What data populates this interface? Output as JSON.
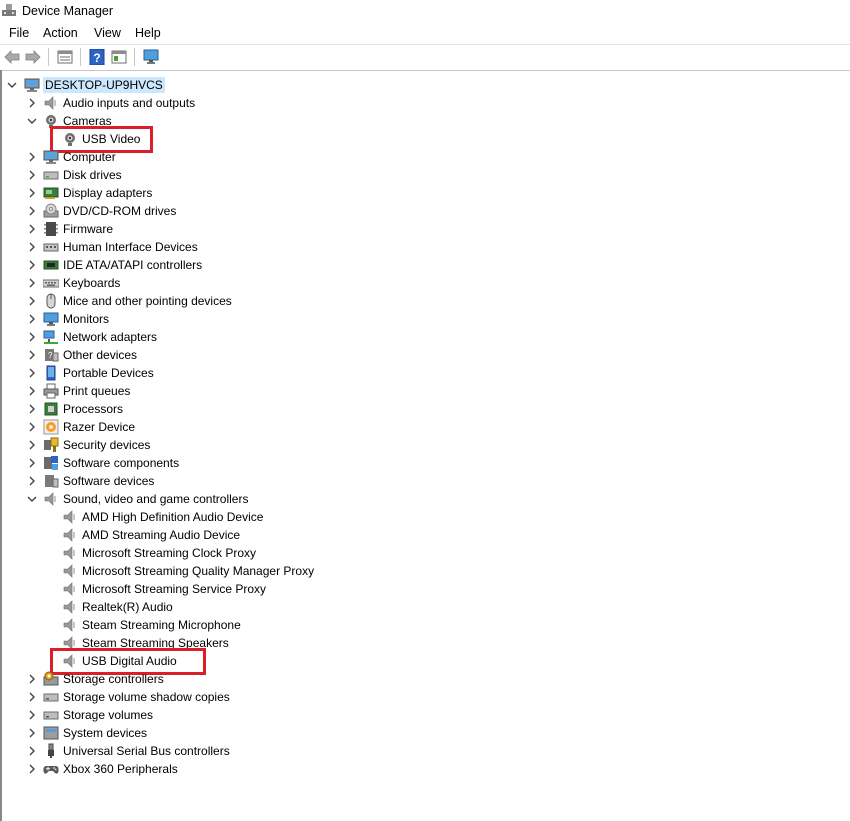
{
  "window": {
    "title": "Device Manager"
  },
  "menu": [
    "File",
    "Action",
    "View",
    "Help"
  ],
  "toolbar": [
    "back-icon",
    "forward-icon",
    "properties-icon",
    "help-icon",
    "view-icon",
    "monitor-icon"
  ],
  "tree": {
    "root": "DESKTOP-UP9HVCS",
    "items": [
      {
        "label": "Audio inputs and outputs",
        "icon": "speaker-icon",
        "level": 1,
        "expand": "collapsed"
      },
      {
        "label": "Cameras",
        "icon": "camera-icon",
        "level": 1,
        "expand": "expanded"
      },
      {
        "label": "USB Video",
        "icon": "camera-icon",
        "level": 2,
        "expand": "none"
      },
      {
        "label": "Computer",
        "icon": "computer-icon",
        "level": 1,
        "expand": "collapsed"
      },
      {
        "label": "Disk drives",
        "icon": "disk-icon",
        "level": 1,
        "expand": "collapsed"
      },
      {
        "label": "Display adapters",
        "icon": "display-adapter-icon",
        "level": 1,
        "expand": "collapsed"
      },
      {
        "label": "DVD/CD-ROM drives",
        "icon": "dvd-icon",
        "level": 1,
        "expand": "collapsed"
      },
      {
        "label": "Firmware",
        "icon": "firmware-icon",
        "level": 1,
        "expand": "collapsed"
      },
      {
        "label": "Human Interface Devices",
        "icon": "hid-icon",
        "level": 1,
        "expand": "collapsed"
      },
      {
        "label": "IDE ATA/ATAPI controllers",
        "icon": "ide-icon",
        "level": 1,
        "expand": "collapsed"
      },
      {
        "label": "Keyboards",
        "icon": "keyboard-icon",
        "level": 1,
        "expand": "collapsed"
      },
      {
        "label": "Mice and other pointing devices",
        "icon": "mouse-icon",
        "level": 1,
        "expand": "collapsed"
      },
      {
        "label": "Monitors",
        "icon": "monitor-icon",
        "level": 1,
        "expand": "collapsed"
      },
      {
        "label": "Network adapters",
        "icon": "network-icon",
        "level": 1,
        "expand": "collapsed"
      },
      {
        "label": "Other devices",
        "icon": "other-devices-icon",
        "level": 1,
        "expand": "collapsed"
      },
      {
        "label": "Portable Devices",
        "icon": "portable-icon",
        "level": 1,
        "expand": "collapsed"
      },
      {
        "label": "Print queues",
        "icon": "printer-icon",
        "level": 1,
        "expand": "collapsed"
      },
      {
        "label": "Processors",
        "icon": "processor-icon",
        "level": 1,
        "expand": "collapsed"
      },
      {
        "label": "Razer Device",
        "icon": "razer-icon",
        "level": 1,
        "expand": "collapsed"
      },
      {
        "label": "Security devices",
        "icon": "security-icon",
        "level": 1,
        "expand": "collapsed"
      },
      {
        "label": "Software components",
        "icon": "software-components-icon",
        "level": 1,
        "expand": "collapsed"
      },
      {
        "label": "Software devices",
        "icon": "software-devices-icon",
        "level": 1,
        "expand": "collapsed"
      },
      {
        "label": "Sound, video and game controllers",
        "icon": "speaker-icon",
        "level": 1,
        "expand": "expanded"
      },
      {
        "label": "AMD High Definition Audio Device",
        "icon": "speaker-icon",
        "level": 2,
        "expand": "none"
      },
      {
        "label": "AMD Streaming Audio Device",
        "icon": "speaker-icon",
        "level": 2,
        "expand": "none"
      },
      {
        "label": "Microsoft Streaming Clock Proxy",
        "icon": "speaker-icon",
        "level": 2,
        "expand": "none"
      },
      {
        "label": "Microsoft Streaming Quality Manager Proxy",
        "icon": "speaker-icon",
        "level": 2,
        "expand": "none"
      },
      {
        "label": "Microsoft Streaming Service Proxy",
        "icon": "speaker-icon",
        "level": 2,
        "expand": "none"
      },
      {
        "label": "Realtek(R) Audio",
        "icon": "speaker-icon",
        "level": 2,
        "expand": "none"
      },
      {
        "label": "Steam Streaming Microphone",
        "icon": "speaker-icon",
        "level": 2,
        "expand": "none"
      },
      {
        "label": "Steam Streaming Speakers",
        "icon": "speaker-icon",
        "level": 2,
        "expand": "none"
      },
      {
        "label": "USB Digital Audio",
        "icon": "speaker-icon",
        "level": 2,
        "expand": "none"
      },
      {
        "label": "Storage controllers",
        "icon": "storage-controller-icon",
        "level": 1,
        "expand": "collapsed"
      },
      {
        "label": "Storage volume shadow copies",
        "icon": "storage-icon",
        "level": 1,
        "expand": "collapsed"
      },
      {
        "label": "Storage volumes",
        "icon": "storage-icon",
        "level": 1,
        "expand": "collapsed"
      },
      {
        "label": "System devices",
        "icon": "system-devices-icon",
        "level": 1,
        "expand": "collapsed"
      },
      {
        "label": "Universal Serial Bus controllers",
        "icon": "usb-icon",
        "level": 1,
        "expand": "collapsed"
      },
      {
        "label": "Xbox 360 Peripherals",
        "icon": "gamepad-icon",
        "level": 1,
        "expand": "collapsed"
      }
    ]
  },
  "highlights": [
    "USB Video",
    "USB Digital Audio"
  ],
  "colors": {
    "highlight_border": "#d9202a",
    "selection": "#cce8ff"
  }
}
